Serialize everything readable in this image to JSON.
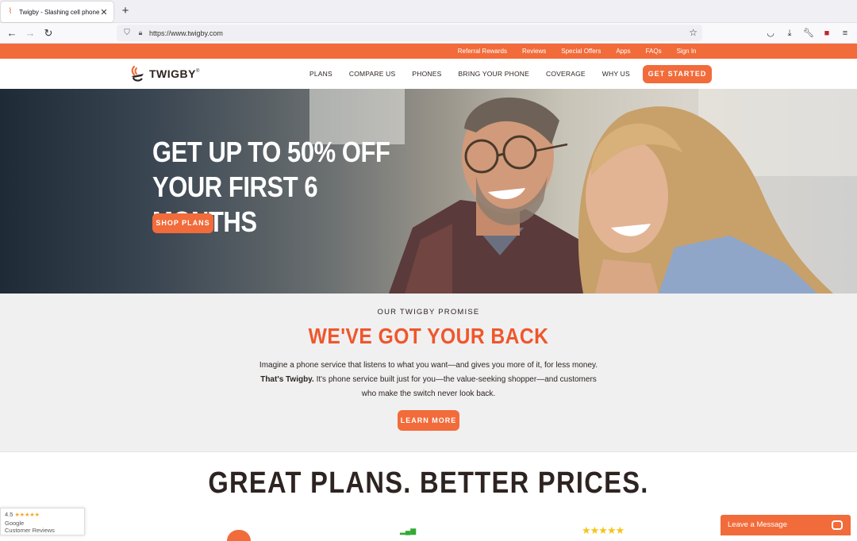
{
  "browser": {
    "tab_title": "Twigby - Slashing cell phone bills",
    "url": "https://www.twigby.com",
    "tab_close": "✕",
    "new_tab": "+"
  },
  "site": {
    "top_links": [
      "Referral Rewards",
      "Reviews",
      "Special Offers",
      "Apps",
      "FAQs",
      "Sign In"
    ],
    "logo_text": "TWIGBY",
    "logo_registered": "®",
    "nav": [
      "PLANS",
      "COMPARE US",
      "PHONES",
      "BRING YOUR PHONE",
      "COVERAGE",
      "WHY US"
    ],
    "get_started": "GET STARTED",
    "brand_color": "#f26b3a"
  },
  "hero": {
    "headline_line1": "GET UP TO 50% OFF",
    "headline_line2": "YOUR FIRST 6 MONTHS",
    "button": "SHOP PLANS"
  },
  "promise": {
    "eyebrow": "OUR TWIGBY PROMISE",
    "title": "WE'VE GOT YOUR BACK",
    "line1": "Imagine a phone service that listens to what you want—and gives you more of it, for less money.",
    "bold": "That's Twigby.",
    "line2": " It's phone service built just for you—the value-seeking shopper—and customers",
    "line3": "who make the switch never look back.",
    "button": "LEARN MORE"
  },
  "plans": {
    "title": "GREAT PLANS. BETTER PRICES."
  },
  "widgets": {
    "review_score": "4.5",
    "review_stars": "★★★★★",
    "review_source": "Google",
    "review_label": "Customer Reviews",
    "chat_label": "Leave a Message"
  }
}
